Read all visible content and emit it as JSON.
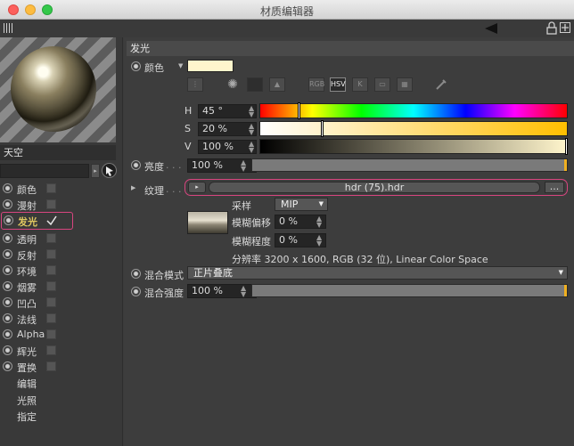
{
  "window": {
    "title": "材质编辑器"
  },
  "colors": {
    "accent": "#f0b020",
    "highlight_border": "#d8457f",
    "selected_channel": "#e0c860"
  },
  "preview": {
    "material_name": "天空"
  },
  "channels": [
    {
      "label": "颜色",
      "checked": false
    },
    {
      "label": "漫射",
      "checked": false
    },
    {
      "label": "发光",
      "checked": true
    },
    {
      "label": "透明",
      "checked": false
    },
    {
      "label": "反射",
      "checked": false
    },
    {
      "label": "环境",
      "checked": false
    },
    {
      "label": "烟雾",
      "checked": false
    },
    {
      "label": "凹凸",
      "checked": false
    },
    {
      "label": "法线",
      "checked": false
    },
    {
      "label": "Alpha",
      "checked": false
    },
    {
      "label": "辉光",
      "checked": false
    },
    {
      "label": "置换",
      "checked": false
    }
  ],
  "extra_items": [
    "编辑",
    "光照",
    "指定"
  ],
  "section": {
    "title": "发光"
  },
  "color": {
    "label": "颜色",
    "swatch": "#fff5cc",
    "mode_buttons": [
      "RGB",
      "HSV",
      "K"
    ],
    "active_mode": "HSV",
    "h": {
      "label": "H",
      "value": "45 °"
    },
    "s": {
      "label": "S",
      "value": "20 %"
    },
    "v": {
      "label": "V",
      "value": "100 %"
    },
    "h_level": 0.125,
    "s_level": 0.2,
    "v_level": 1.0
  },
  "brightness": {
    "label": "亮度",
    "value": "100 %",
    "level": 1.0
  },
  "texture": {
    "label": "纹理",
    "file": "hdr (75).hdr",
    "more_button": "...",
    "sampling_label": "采样",
    "sampling_value": "MIP",
    "blur_offset_label": "模糊偏移",
    "blur_offset_value": "0 %",
    "blur_degree_label": "模糊程度",
    "blur_degree_value": "0 %",
    "resolution": "分辨率 3200 x 1600, RGB (32 位), Linear Color Space"
  },
  "mix_mode": {
    "label": "混合模式",
    "value": "正片叠底"
  },
  "mix_strength": {
    "label": "混合强度",
    "value": "100 %",
    "level": 1.0
  }
}
